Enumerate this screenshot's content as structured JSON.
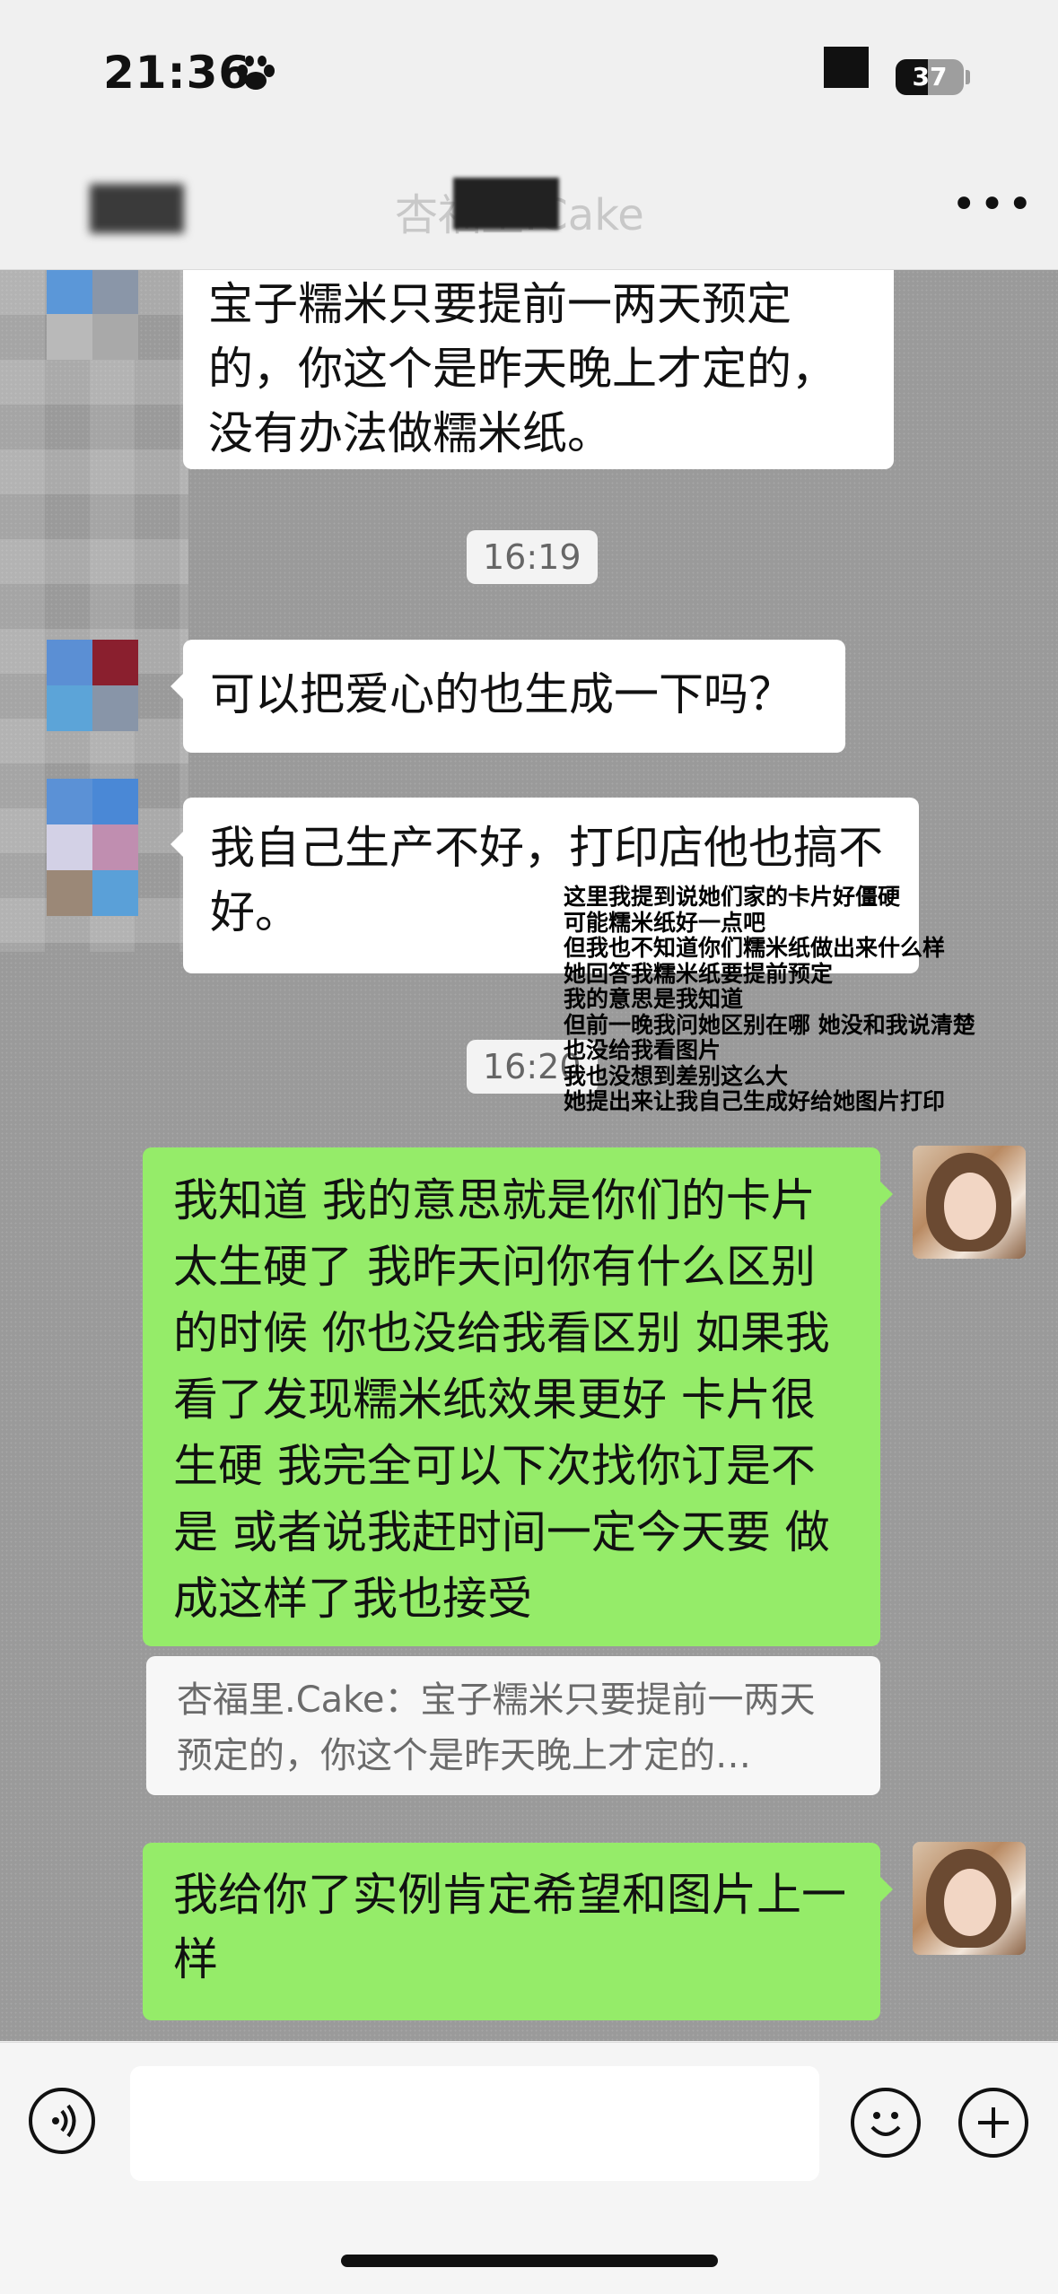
{
  "status": {
    "time": "21:36",
    "battery": "37"
  },
  "nav": {
    "title": "杏福里.Cake"
  },
  "messages": [
    {
      "text": "宝子糯米只要提前一两天预定的，你这个是昨天晚上才定的，没有办法做糯米纸。"
    },
    {
      "time": "16:19"
    },
    {
      "text": "可以把爱心的也生成一下吗？"
    },
    {
      "text": "我自己生产不好，打印店他也搞不好。"
    },
    {
      "time": "16:20"
    },
    {
      "text": "我知道 我的意思就是你们的卡片太生硬了 我昨天问你有什么区别的时候 你也没给我看区别 如果我看了发现糯米纸效果更好 卡片很生硬 我完全可以下次找你订是不是 或者说我赶时间一定今天要 做成这样了我也接受"
    },
    {
      "quote": "杏福里.Cake：宝子糯米只要提前一两天预定的，你这个是昨天晚上才定的…"
    },
    {
      "text": "我给你了实例肯定希望和图片上一样"
    }
  ],
  "overlay_note": "这里我提到说她们家的卡片好僵硬\n可能糯米纸好一点吧\n但我也不知道你们糯米纸做出来什么样\n她回答我糯米纸要提前预定\n我的意思是我知道\n但前一晚我问她区别在哪 她没和我说清楚也没给我看图片\n我也没想到差别这么大\n她提出来让我自己生成好给她图片打印",
  "icons": {
    "paw": "paw-icon",
    "more": "more-icon",
    "voice": "voice-icon",
    "emoji": "emoji-icon",
    "plus": "plus-icon"
  },
  "colors": {
    "sent_bubble": "#95ec69",
    "received_bubble": "#ffffff"
  }
}
